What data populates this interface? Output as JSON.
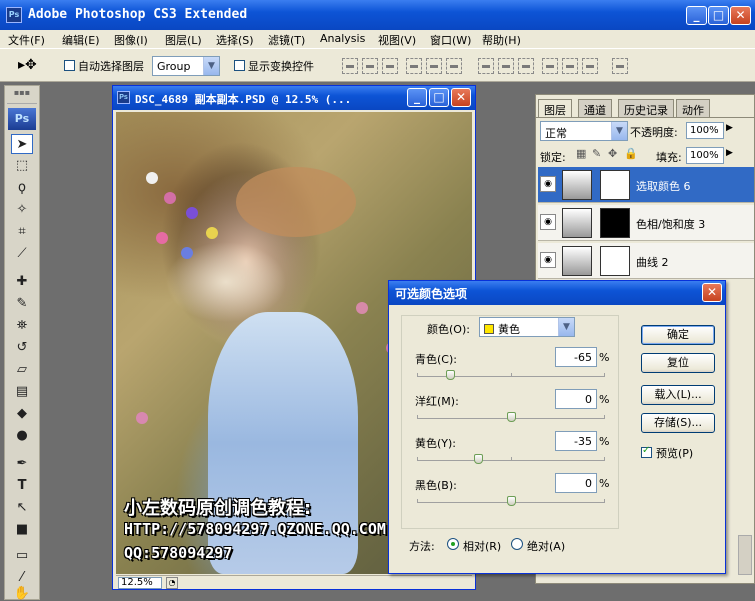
{
  "app": {
    "title": "Adobe Photoshop CS3 Extended",
    "logo": "Ps"
  },
  "menu": {
    "items": [
      "文件(F)",
      "编辑(E)",
      "图像(I)",
      "图层(L)",
      "选择(S)",
      "滤镜(T)",
      "Analysis",
      "视图(V)",
      "窗口(W)",
      "帮助(H)"
    ]
  },
  "options": {
    "auto_select_label": "自动选择图层",
    "auto_select_value": "Group",
    "show_transform_label": "显示变换控件"
  },
  "toolbox": {
    "logo": "Ps",
    "tools": [
      "move-tool",
      "marquee-tool",
      "lasso-tool",
      "magic-wand-tool",
      "crop-tool",
      "slice-tool",
      "healing-brush-tool",
      "brush-tool",
      "clone-stamp-tool",
      "history-brush-tool",
      "eraser-tool",
      "gradient-tool",
      "blur-tool",
      "dodge-tool",
      "pen-tool",
      "type-tool",
      "path-selection-tool",
      "shape-tool",
      "notes-tool",
      "eyedropper-tool",
      "hand-tool"
    ]
  },
  "document": {
    "title": "DSC_4689 副本副本.PSD @ 12.5% (...",
    "zoom": "12.5%",
    "watermark_line1": "小左数码原创调色教程:",
    "watermark_line2": "HTTP://578094297.QZONE.QQ.COM",
    "watermark_line3": "QQ:578094297"
  },
  "layers_panel": {
    "tabs": [
      "图层",
      "通道",
      "历史记录",
      "动作"
    ],
    "blend_mode": "正常",
    "opacity_label": "不透明度:",
    "opacity_value": "100%",
    "lock_label": "锁定:",
    "fill_label": "填充:",
    "fill_value": "100%",
    "layers": [
      {
        "name": "选取颜色 6",
        "active": true
      },
      {
        "name": "色相/饱和度 3",
        "active": false
      },
      {
        "name": "曲线 2",
        "active": false
      }
    ]
  },
  "dialog": {
    "title": "可选颜色选项",
    "color_label": "颜色(O):",
    "color_value": "黄色",
    "color_swatch": "#ffe600",
    "sliders": [
      {
        "label": "青色(C):",
        "value": "-65",
        "amount": -65
      },
      {
        "label": "洋红(M):",
        "value": "0",
        "amount": 0
      },
      {
        "label": "黄色(Y):",
        "value": "-35",
        "amount": -35
      },
      {
        "label": "黑色(B):",
        "value": "0",
        "amount": 0
      }
    ],
    "percent": "%",
    "method_label": "方法:",
    "method_relative": "相对(R)",
    "method_absolute": "绝对(A)",
    "method_selected": "relative",
    "buttons": {
      "ok": "确定",
      "reset": "复位",
      "load": "载入(L)...",
      "save": "存储(S)..."
    },
    "preview_label": "预览(P)",
    "preview_checked": true
  }
}
